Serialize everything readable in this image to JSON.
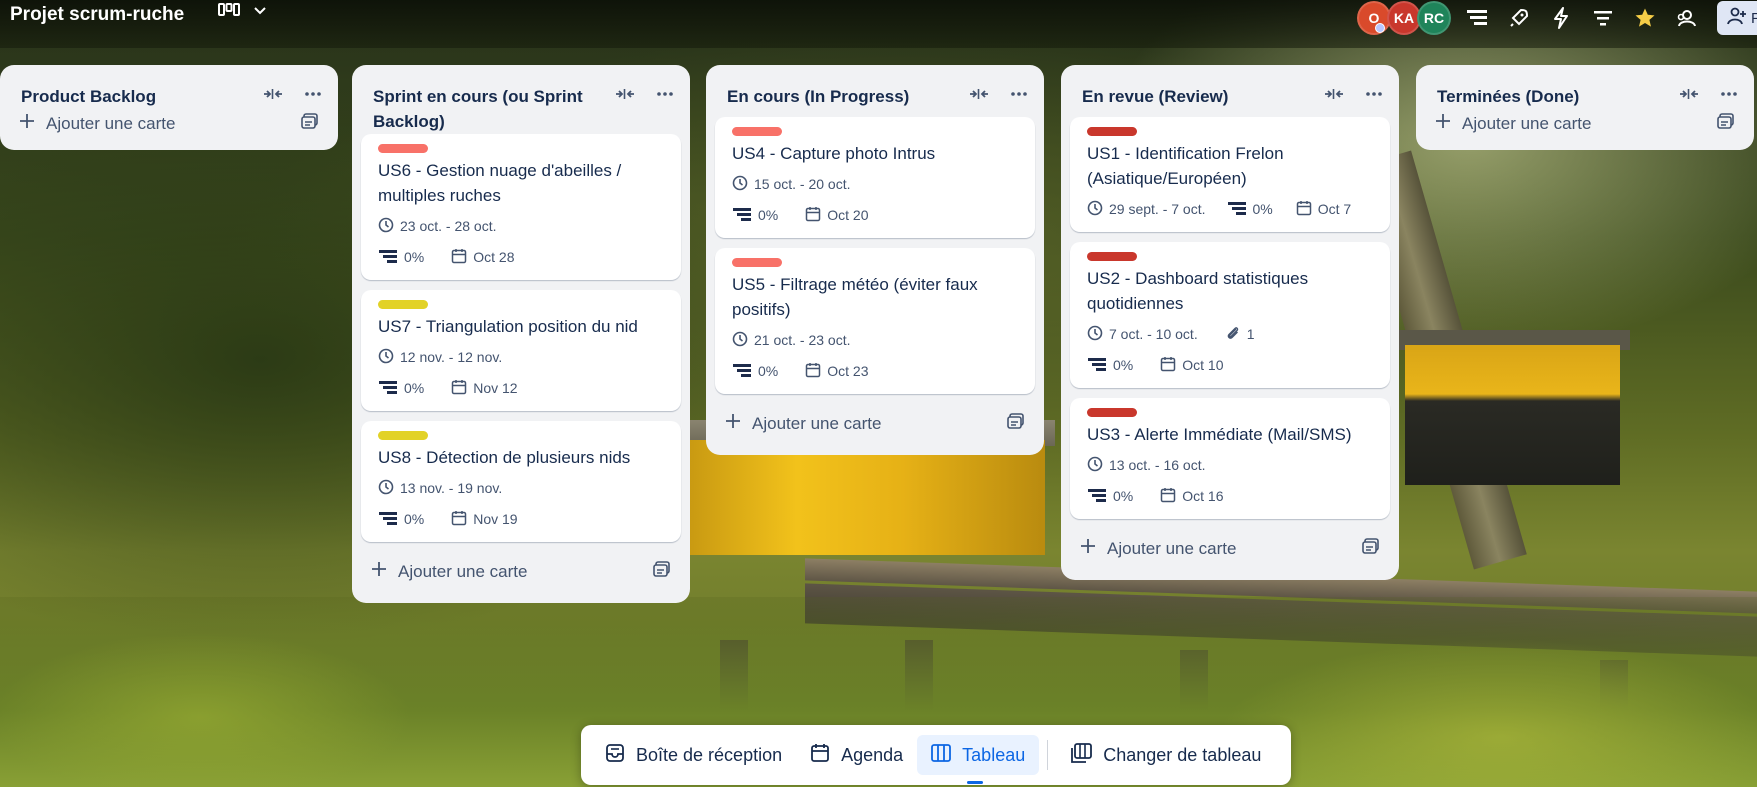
{
  "header": {
    "title": "Projet scrum-ruche",
    "view_icon": "board-view-icon",
    "avatars": [
      {
        "initials": "O",
        "color": "#d94a2b"
      },
      {
        "initials": "KA",
        "color": "#c9372c"
      },
      {
        "initials": "RC",
        "color": "#1f845a"
      }
    ],
    "share_label": "Pa"
  },
  "lists": [
    {
      "title": "Product Backlog",
      "add_label": "Ajouter une carte",
      "cards": []
    },
    {
      "title": "Sprint en cours (ou Sprint Backlog)",
      "add_label": "Ajouter une carte",
      "cards": [
        {
          "label_color": "#f87168",
          "title": "US6 - Gestion nuage d'abeilles / multiples ruches",
          "dates": "23 oct. - 28 oct.",
          "progress": "0%",
          "due": "Oct 28"
        },
        {
          "label_color": "#e2d227",
          "title": "US7 - Triangulation position du nid",
          "dates": "12 nov. - 12 nov.",
          "progress": "0%",
          "due": "Nov 12"
        },
        {
          "label_color": "#e2d227",
          "title": "US8 - Détection de plusieurs nids",
          "dates": "13 nov. - 19 nov.",
          "progress": "0%",
          "due": "Nov 19"
        }
      ]
    },
    {
      "title": "En cours (In Progress)",
      "add_label": "Ajouter une carte",
      "cards": [
        {
          "label_color": "#f87168",
          "title": "US4 - Capture photo Intrus",
          "dates": "15 oct. - 20 oct.",
          "progress": "0%",
          "due": "Oct 20"
        },
        {
          "label_color": "#f87168",
          "title": "US5 - Filtrage météo (éviter faux positifs)",
          "dates": "21 oct. - 23 oct.",
          "progress": "0%",
          "due": "Oct 23"
        }
      ]
    },
    {
      "title": "En revue (Review)",
      "add_label": "Ajouter une carte",
      "cards": [
        {
          "label_color": "#c9372c",
          "title": "US1 - Identification Frelon (Asiatique/Européen)",
          "dates": "29 sept. - 7 oct.",
          "progress": "0%",
          "due": "Oct 7",
          "inline": true
        },
        {
          "label_color": "#c9372c",
          "title": "US2 - Dashboard statistiques quotidiennes",
          "dates": "7 oct. - 10 oct.",
          "attachments": "1",
          "progress": "0%",
          "due": "Oct 10"
        },
        {
          "label_color": "#c9372c",
          "title": "US3 - Alerte Immédiate (Mail/SMS)",
          "dates": "13 oct. - 16 oct.",
          "progress": "0%",
          "due": "Oct 16"
        }
      ]
    },
    {
      "title": "Terminées (Done)",
      "add_label": "Ajouter une carte",
      "cards": []
    }
  ],
  "bottom_nav": {
    "inbox": "Boîte de réception",
    "planner": "Agenda",
    "board": "Tableau",
    "switch": "Changer de tableau"
  }
}
